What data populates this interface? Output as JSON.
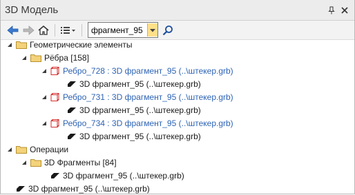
{
  "window": {
    "title": "3D Модель"
  },
  "toolbar": {
    "search_value": "фрагмент_95",
    "icons": [
      "back-arrow-icon",
      "forward-arrow-icon",
      "home-icon",
      "list-view-icon",
      "search-icon"
    ]
  },
  "tree": {
    "geometric": "Геометрические элементы",
    "edges": "Рёбра [158]",
    "edge1": "Ребро_728 : 3D фрагмент_95 (..\\штекер.grb)",
    "edge1_child": "3D фрагмент_95 (..\\штекер.grb)",
    "edge2": "Ребро_731 : 3D фрагмент_95 (..\\штекер.grb)",
    "edge2_child": "3D фрагмент_95 (..\\штекер.grb)",
    "edge3": "Ребро_734 : 3D фрагмент_95 (..\\штекер.grb)",
    "edge3_child": "3D фрагмент_95 (..\\штекер.grb)",
    "operations": "Операции",
    "fragments": "3D Фрагменты [84]",
    "fragment_child": "3D фрагмент_95 (..\\штекер.grb)",
    "root_item": "3D фрагмент_95 (..\\штекер.grb)"
  },
  "colors": {
    "link": "#2d63b4",
    "folder": "#f3d27a",
    "edge_icon": "#d42b2b"
  }
}
